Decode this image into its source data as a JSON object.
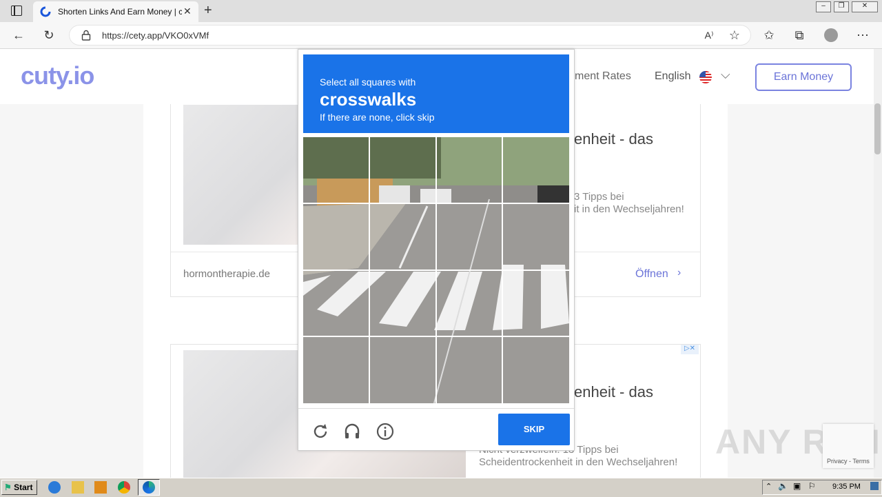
{
  "browser": {
    "tab_title": "Shorten Links And Earn Money | c",
    "url": "https://cety.app/VKO0xVMf",
    "icons": [
      "tab-actions-icon",
      "close-icon",
      "new-tab-icon",
      "back-icon",
      "refresh-icon",
      "lock-icon",
      "read-aloud-icon",
      "add-favorite-icon",
      "favorites-icon",
      "collections-icon",
      "profile-icon",
      "more-icon"
    ]
  },
  "site": {
    "logo": "cuty.io",
    "nav_rates": "ment Rates",
    "nav_language": "English",
    "earn_button": "Earn Money"
  },
  "ads": [
    {
      "headline": "enheit - das",
      "sub1": "3 Tipps bei",
      "sub2": "it in den Wechseljahren!",
      "domain": "hormontherapie.de",
      "cta": "Öffnen"
    },
    {
      "headline": "enheit - das",
      "sub1": "Nicht verzweifeln: 13 Tipps bei",
      "sub2": "Scheidentrockenheit in den Wechseljahren!"
    }
  ],
  "captcha": {
    "instruction": "Select all squares with",
    "target": "crosswalks",
    "hint": "If there are none, click skip",
    "skip_label": "SKIP",
    "icons": [
      "reload-icon",
      "audio-icon",
      "info-icon"
    ]
  },
  "recaptcha_badge": "Privacy - Terms",
  "watermark": "ANY RUN",
  "taskbar": {
    "start_label": "Start",
    "clock": "9:35 PM"
  },
  "colors": {
    "captcha_blue": "#1a73e8",
    "logo": "#8b93e8"
  }
}
